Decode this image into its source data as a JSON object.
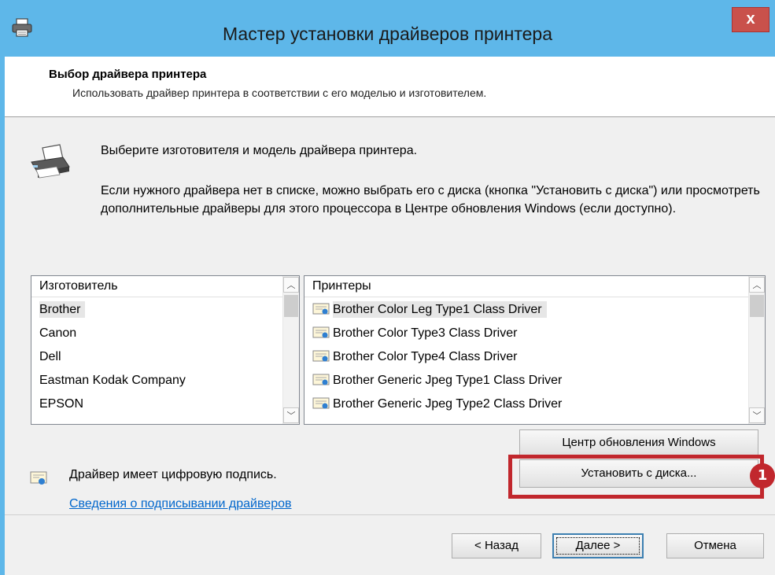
{
  "window": {
    "title": "Мастер установки драйверов принтера",
    "close_label": "x"
  },
  "header": {
    "title": "Выбор драйвера принтера",
    "subtitle": "Использовать драйвер принтера в соответствии с его моделью и изготовителем."
  },
  "instructions": {
    "line1": "Выберите изготовителя и модель драйвера принтера.",
    "line2": "Если нужного драйвера нет в списке, можно выбрать его с диска (кнопка \"Установить с диска\") или просмотреть дополнительные драйверы для этого процессора в Центре обновления Windows (если доступно)."
  },
  "manufacturers": {
    "header": "Изготовитель",
    "items": [
      "Brother",
      "Canon",
      "Dell",
      "Eastman Kodak Company",
      "EPSON"
    ],
    "selected_index": 0
  },
  "printers": {
    "header": "Принтеры",
    "items": [
      "Brother Color Leg Type1 Class Driver",
      "Brother Color Type3 Class Driver",
      "Brother Color Type4 Class Driver",
      "Brother Generic Jpeg Type1 Class Driver",
      "Brother Generic Jpeg Type2 Class Driver"
    ],
    "selected_index": 0
  },
  "buttons": {
    "windows_update": "Центр обновления Windows",
    "have_disk": "Установить с диска...",
    "back": "< Назад",
    "next": "Далее >",
    "cancel": "Отмена"
  },
  "signature": {
    "text": "Драйвер имеет цифровую подпись.",
    "link": "Сведения о подписывании драйверов"
  },
  "annotation": {
    "badge": "1",
    "color": "#c1272d"
  },
  "icons": [
    "printer-icon",
    "printer-illustration-icon",
    "driver-certificate-icon",
    "scroll-up-icon",
    "scroll-down-icon"
  ]
}
